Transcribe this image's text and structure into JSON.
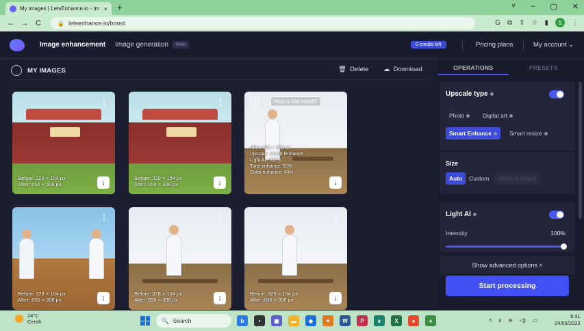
{
  "browser": {
    "tab_title": "My images | LetsEnhance.io - Im",
    "tab_close": "×",
    "new_tab": "+",
    "url": "letsenhance.io/boost",
    "window_controls": [
      "˅",
      "–",
      "▢",
      "✕"
    ],
    "nav": {
      "back": "←",
      "forward": "→",
      "reload": "C"
    }
  },
  "appbar": {
    "nav_image_enhancement": "Image enhancement",
    "nav_image_generation": "Image generation",
    "beta_badge": "Beta",
    "credits": "0 credits left",
    "pricing": "Pricing plans",
    "account": "My account"
  },
  "toolbar": {
    "title": "MY IMAGES",
    "delete": "Delete",
    "download": "Download"
  },
  "images": [
    {
      "before": "Before: 328 × 154 px",
      "after": "After:   656 × 308 px"
    },
    {
      "before": "Before: 328 × 154 px",
      "after": "After:   656 × 308 px"
    },
    {
      "result_prompt": "How is the result?",
      "lines": [
        "After: 656 × 308 px",
        "Upscale: Smart Enhance",
        "Light AI: 100%",
        "Tone enhance: 50%",
        "Color enhance: 40%"
      ]
    },
    {
      "before": "Before: 328 × 154 px",
      "after": "After:   656 × 308 px"
    },
    {
      "before": "Before: 328 × 154 px",
      "after": "After:   656 × 308 px"
    },
    {
      "before": "Before: 328 × 154 px",
      "after": "After:   656 × 308 px"
    }
  ],
  "panel": {
    "tab_operations": "OPERATIONS",
    "tab_presets": "PRESETS",
    "upscale_type_title": "Upscale type",
    "upscale_options": [
      "Photo",
      "Digital art",
      "Smart Enhance",
      "Smart resize"
    ],
    "size_title": "Size",
    "size_options": [
      "Auto",
      "Custom",
      "Width & Height"
    ],
    "light_ai_title": "Light AI",
    "intensity_label": "Intensity",
    "intensity_value": "100%",
    "intensity_level": 1.0,
    "advanced": "Show advanced options",
    "start": "Start processing"
  },
  "taskbar": {
    "temperature": "24°C",
    "condition": "Cerah",
    "search": "Search",
    "time": "9:31",
    "date": "24/05/2023"
  },
  "colors": {
    "accent": "#4150f2",
    "app_bg": "#1d1e30",
    "chrome": "#c8ebcd"
  }
}
